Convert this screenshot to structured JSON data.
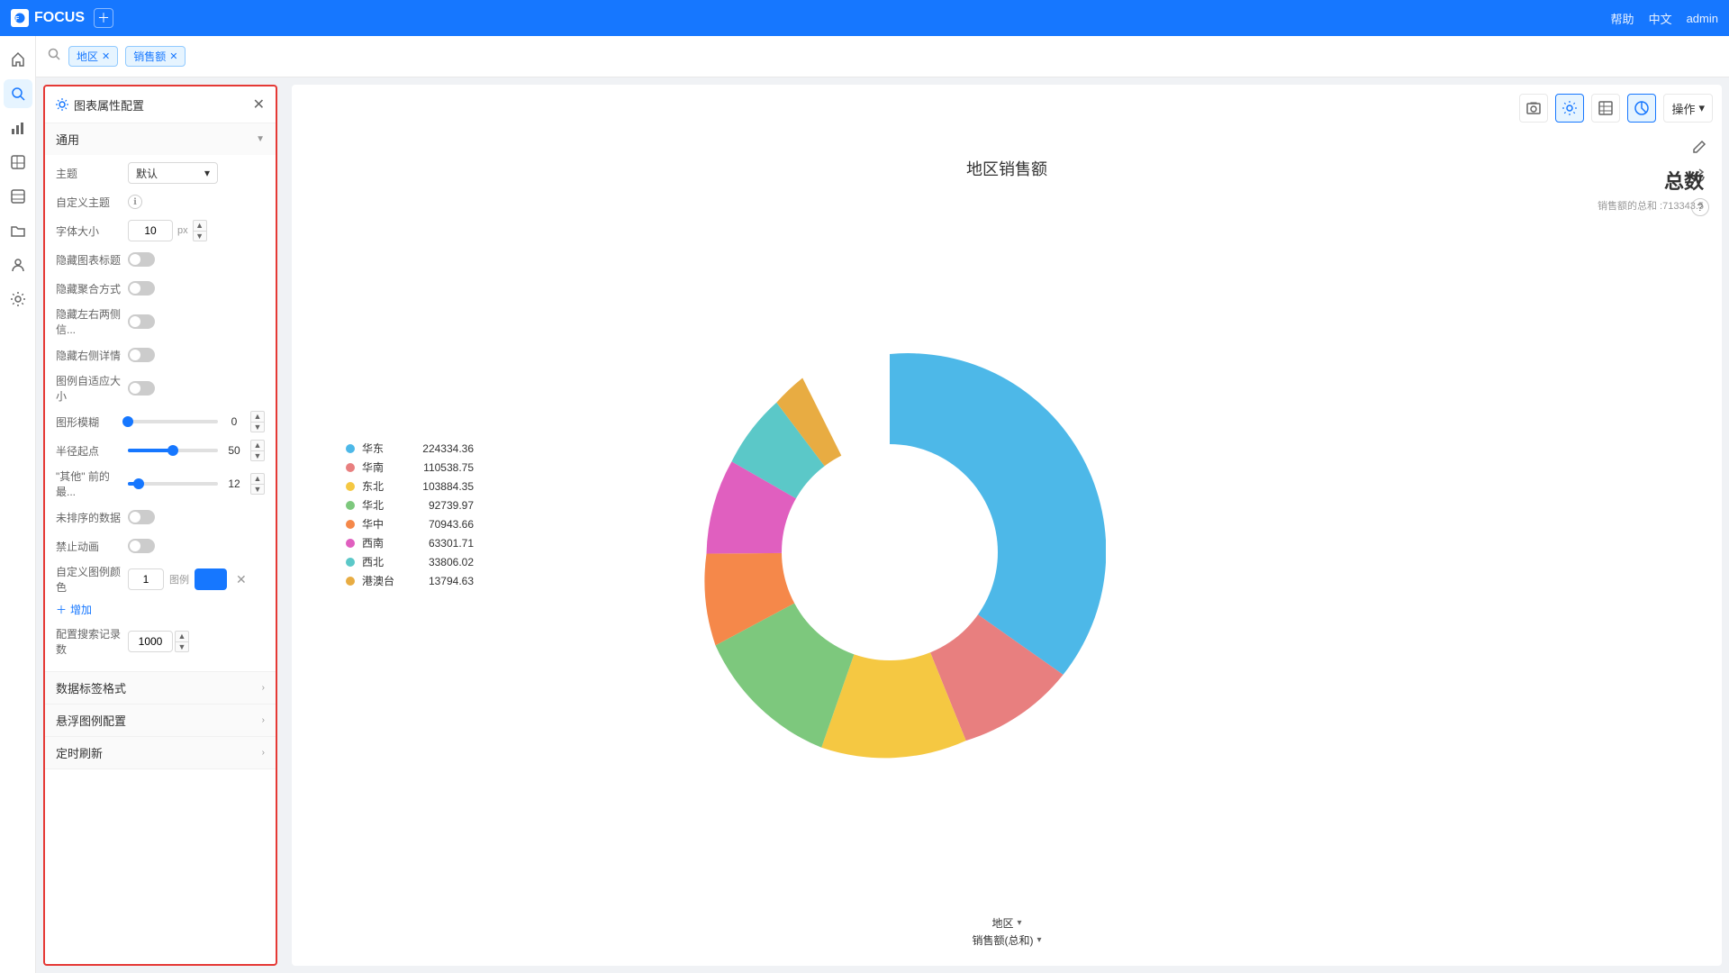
{
  "topbar": {
    "logo_text": "FOCUS",
    "help_label": "帮助",
    "lang_label": "中文",
    "user_label": "admin"
  },
  "search_bar": {
    "tags": [
      {
        "label": "地区",
        "key": "region"
      },
      {
        "label": "销售额",
        "key": "sales"
      }
    ]
  },
  "config_panel": {
    "title": "图表属性配置",
    "sections": {
      "general": {
        "label": "通用",
        "theme_label": "主题",
        "theme_value": "默认",
        "custom_theme_label": "自定义主题",
        "font_size_label": "字体大小",
        "font_size_value": "10",
        "font_size_unit": "px",
        "hide_title_label": "隐藏图表标题",
        "hide_aggregate_label": "隐藏聚合方式",
        "hide_left_right_label": "隐藏左右两侧信...",
        "hide_right_detail_label": "隐藏右侧详情",
        "legend_auto_size_label": "图例自适应大小",
        "graph_blur_label": "图形模糊",
        "graph_blur_value": "0",
        "radius_start_label": "半径起点",
        "radius_start_value": "50",
        "other_prefix_label": "\"其他\" 前的最...",
        "other_prefix_value": "12",
        "unsorted_label": "未排序的数据",
        "disable_anim_label": "禁止动画",
        "custom_color_label": "自定义图例颜色",
        "custom_color_num": "1",
        "custom_color_name": "图例",
        "add_label": "增加",
        "records_label": "配置搜索记录数",
        "records_value": "1000"
      },
      "data_format": {
        "label": "数据标签格式"
      },
      "float_legend": {
        "label": "悬浮图例配置"
      },
      "timer": {
        "label": "定时刷新"
      }
    }
  },
  "chart": {
    "title": "地区销售额",
    "total_label": "总数",
    "total_sublabel": "销售额的总和 :713343.5",
    "data": [
      {
        "name": "华东",
        "value": 224334.36,
        "color": "#4db8e8",
        "percent": 31.5
      },
      {
        "name": "华南",
        "value": 110538.75,
        "color": "#e87f7f",
        "percent": 15.5
      },
      {
        "name": "东北",
        "value": 103884.35,
        "color": "#f5c842",
        "percent": 14.6
      },
      {
        "name": "华北",
        "value": 92739.97,
        "color": "#7dc87d",
        "percent": 13.0
      },
      {
        "name": "华中",
        "value": 70943.66,
        "color": "#f5884a",
        "percent": 9.9
      },
      {
        "name": "西南",
        "value": 63301.71,
        "color": "#e05fbf",
        "percent": 8.9
      },
      {
        "name": "西北",
        "value": 33806.02,
        "color": "#5bc8c8",
        "percent": 4.7
      },
      {
        "name": "港澳台",
        "value": 13794.63,
        "color": "#e8ac42",
        "percent": 1.9
      }
    ],
    "axis_labels": [
      "地区",
      "销售额(总和)"
    ]
  },
  "toolbar": {
    "ops_label": "操作"
  },
  "icons": {
    "search": "🔍",
    "settings": "⚙",
    "home": "⌂",
    "chart": "📊",
    "question": "?",
    "list": "☰",
    "folder": "📁",
    "user": "👤",
    "gear": "⚙"
  }
}
